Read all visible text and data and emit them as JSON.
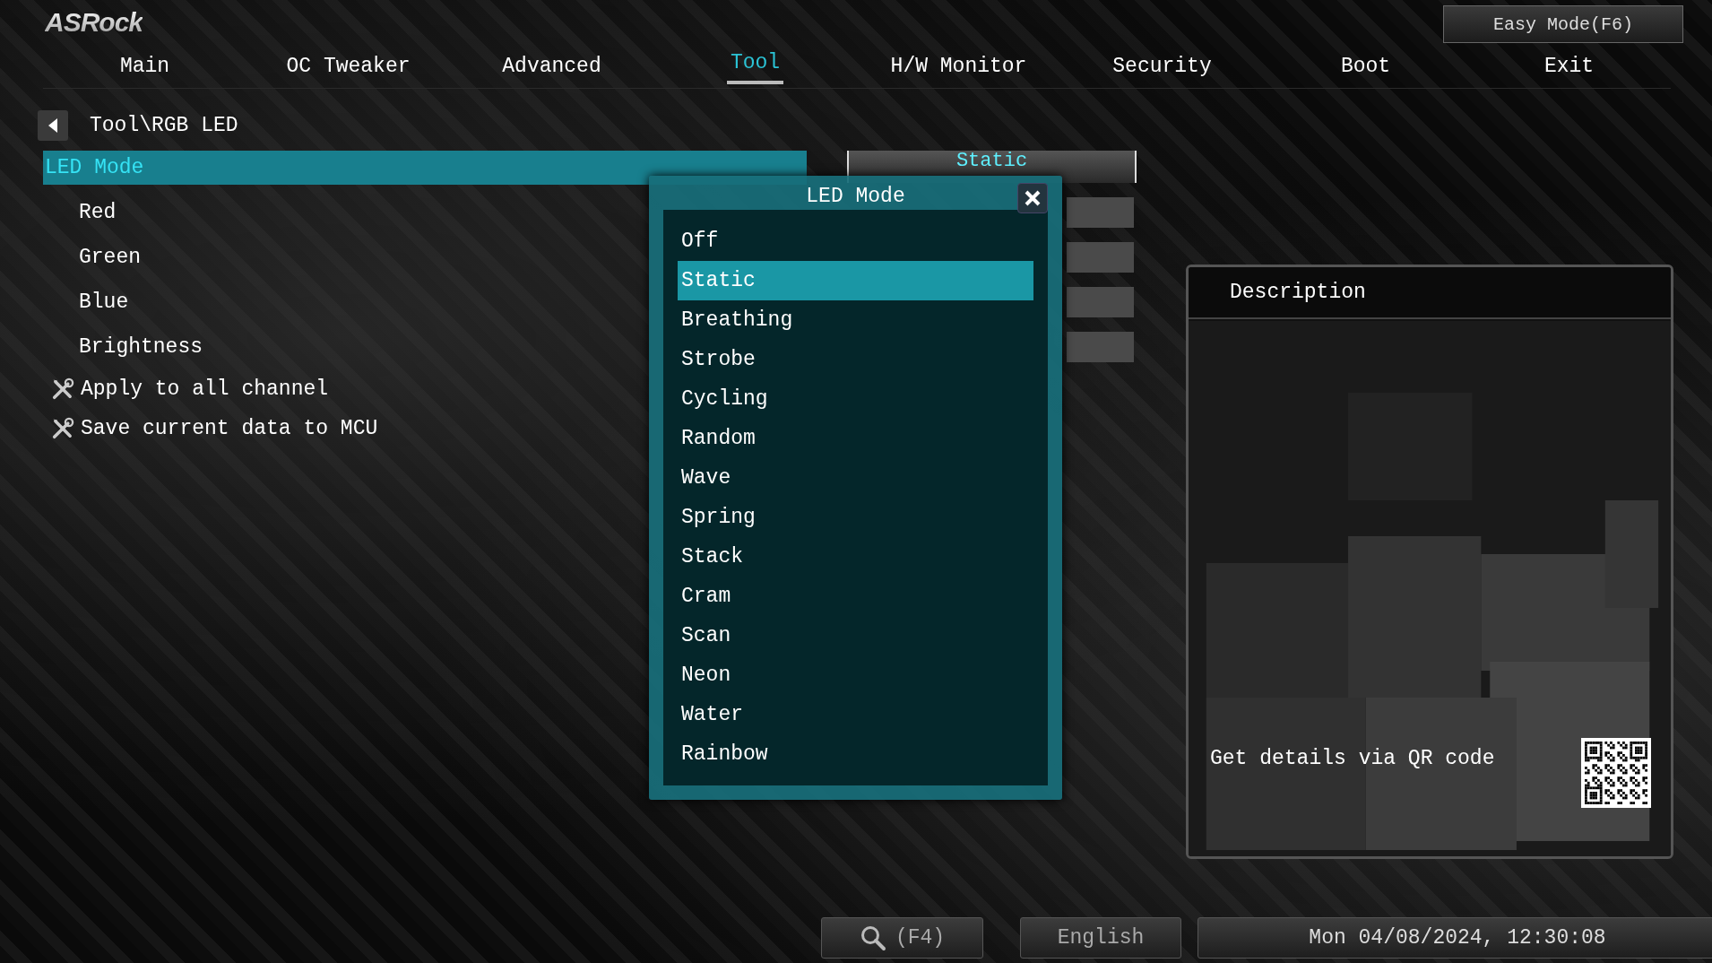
{
  "logo": {
    "text": "ASRock"
  },
  "easy_mode_button": "Easy Mode(F6)",
  "tabs": [
    {
      "label": "Main",
      "selected": false
    },
    {
      "label": "OC Tweaker",
      "selected": false
    },
    {
      "label": "Advanced",
      "selected": false
    },
    {
      "label": "Tool",
      "selected": true
    },
    {
      "label": "H/W Monitor",
      "selected": false
    },
    {
      "label": "Security",
      "selected": false
    },
    {
      "label": "Boot",
      "selected": false
    },
    {
      "label": "Exit",
      "selected": false
    }
  ],
  "breadcrumb": "Tool\\RGB LED",
  "menu_items": [
    {
      "label": "LED Mode",
      "kind": "option",
      "selected": true,
      "value": "Static"
    },
    {
      "label": "Red",
      "kind": "option",
      "selected": false
    },
    {
      "label": "Green",
      "kind": "option",
      "selected": false
    },
    {
      "label": "Blue",
      "kind": "option",
      "selected": false
    },
    {
      "label": "Brightness",
      "kind": "option",
      "selected": false
    },
    {
      "label": "Apply to all channel",
      "kind": "tool",
      "selected": false
    },
    {
      "label": "Save current data to MCU",
      "kind": "tool",
      "selected": false
    }
  ],
  "popup": {
    "title": "LED Mode",
    "options": [
      {
        "label": "Off",
        "selected": false
      },
      {
        "label": "Static",
        "selected": true
      },
      {
        "label": "Breathing",
        "selected": false
      },
      {
        "label": "Strobe",
        "selected": false
      },
      {
        "label": "Cycling",
        "selected": false
      },
      {
        "label": "Random",
        "selected": false
      },
      {
        "label": "Wave",
        "selected": false
      },
      {
        "label": "Spring",
        "selected": false
      },
      {
        "label": "Stack",
        "selected": false
      },
      {
        "label": "Cram",
        "selected": false
      },
      {
        "label": "Scan",
        "selected": false
      },
      {
        "label": "Neon",
        "selected": false
      },
      {
        "label": "Water",
        "selected": false
      },
      {
        "label": "Rainbow",
        "selected": false
      }
    ]
  },
  "description": {
    "title": "Description",
    "qr_text": "Get details via QR code"
  },
  "footer": {
    "search": "(F4)",
    "language": "English",
    "datetime": "Mon 04/08/2024, 12:30:08"
  }
}
